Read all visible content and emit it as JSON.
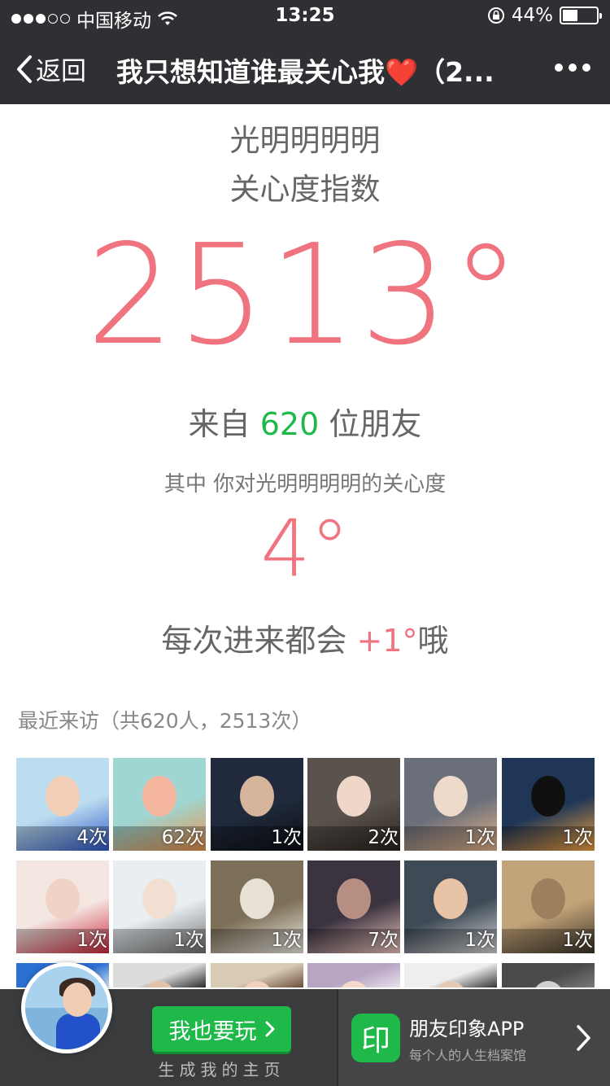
{
  "status_bar": {
    "carrier": "中国移动",
    "time": "13:25",
    "battery_percent": "44%",
    "battery_level": 0.44
  },
  "nav": {
    "back_label": "返回",
    "title": "我只想知道谁最关心我❤️（2...",
    "more_icon": "more-dots-icon"
  },
  "main": {
    "owner_name": "光明明明明",
    "index_label": "关心度指数",
    "total_degree": "2513°",
    "from_prefix": "来自 ",
    "friend_count": "620",
    "from_suffix": " 位朋友",
    "your_degree_text": "其中 你对光明明明明的关心度",
    "your_degree": "4°",
    "increment_prefix": "每次进来都会 ",
    "increment_value": "+1°",
    "increment_suffix": "哦"
  },
  "visits": {
    "title": "最近来访（共620人，2513次）",
    "tiles": [
      {
        "count": "4次"
      },
      {
        "count": "62次"
      },
      {
        "count": "1次"
      },
      {
        "count": "2次"
      },
      {
        "count": "1次"
      },
      {
        "count": "1次"
      },
      {
        "count": "1次"
      },
      {
        "count": "1次"
      },
      {
        "count": "1次"
      },
      {
        "count": "7次"
      },
      {
        "count": "1次"
      },
      {
        "count": "1次"
      },
      {
        "count": ""
      },
      {
        "count": ""
      },
      {
        "count": ""
      },
      {
        "count": ""
      },
      {
        "count": ""
      },
      {
        "count": ""
      }
    ]
  },
  "bottom": {
    "play_label": "我也要玩",
    "page_label": "生成我的主页",
    "app_icon_char": "印",
    "app_name": "朋友印象APP",
    "app_desc": "每个人的人生档案馆"
  },
  "colors": {
    "accent_green": "#1fb94a",
    "accent_pink": "#f07480",
    "bar_dark": "#2e3033"
  }
}
